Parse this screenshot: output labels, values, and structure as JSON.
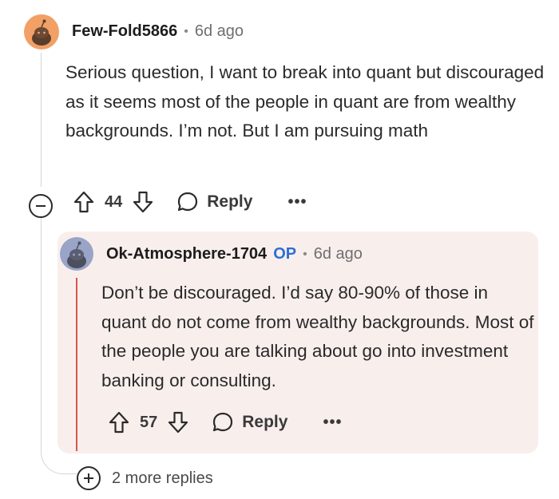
{
  "comment": {
    "username": "Few-Fold5866",
    "time_ago": "6d ago",
    "body": "Serious question, I want to break into quant but discouraged as it seems most of the people in quant are from wealthy backgrounds. I’m not. But I am pursuing math",
    "score": "44",
    "reply_label": "Reply",
    "more_label": "•••",
    "avatar_icon": "snoo-avatar-icon",
    "avatar_color": "#f2a066"
  },
  "reply": {
    "username": "Ok-Atmosphere-1704",
    "badge": "OP",
    "time_ago": "6d ago",
    "body": "Don’t be discouraged. I’d say 80-90% of those in quant do not come from wealthy backgrounds. Most of the people you are talking about go into investment banking or consulting.",
    "score": "57",
    "reply_label": "Reply",
    "more_label": "•••",
    "avatar_icon": "snoo-avatar-icon",
    "avatar_color": "#9aa4c7",
    "card_color": "#f8efec",
    "accent_color": "#d8564a"
  },
  "thread": {
    "separator": "•",
    "more_replies_label": "2 more replies",
    "collapse_icon": "minus-circle-icon",
    "expand_icon": "plus-circle-icon"
  }
}
